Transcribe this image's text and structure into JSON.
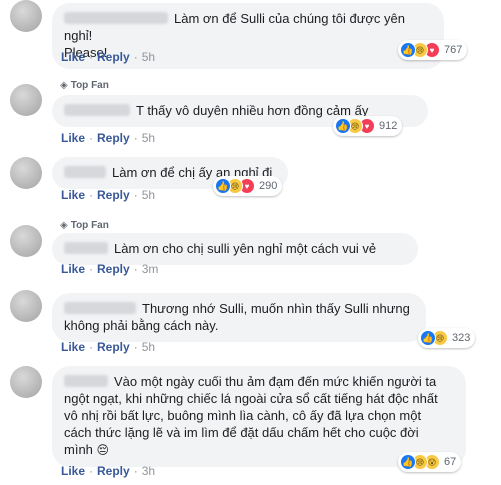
{
  "comments": [
    {
      "top_fan": "",
      "text_lines": [
        "Làm ơn để Sulli của chúng tôi được yên nghỉ!",
        "Please!"
      ],
      "like": "Like",
      "reply": "Reply",
      "time": "5h",
      "reaction_count": "767",
      "reaction_icons": [
        "like-icon",
        "sad-icon",
        "love-icon"
      ]
    },
    {
      "top_fan": "Top Fan",
      "text_lines": [
        "T thấy vô duyên nhiều hơn đồng cảm ấy"
      ],
      "like": "Like",
      "reply": "Reply",
      "time": "5h",
      "reaction_count": "912",
      "reaction_icons": [
        "like-icon",
        "sad-icon",
        "love-icon"
      ]
    },
    {
      "top_fan": "",
      "text_lines": [
        "Làm ơn để chị ấy an nghỉ đi"
      ],
      "like": "Like",
      "reply": "Reply",
      "time": "5h",
      "reaction_count": "290",
      "reaction_icons": [
        "like-icon",
        "sad-icon",
        "love-icon"
      ]
    },
    {
      "top_fan": "Top Fan",
      "text_lines": [
        "Làm ơn cho chị sulli yên nghỉ một cách vui vẻ"
      ],
      "like": "Like",
      "reply": "Reply",
      "time": "3m",
      "reaction_count": "",
      "reaction_icons": []
    },
    {
      "top_fan": "",
      "text_lines": [
        "Thương nhớ Sulli, muốn nhìn thấy Sulli nhưng",
        "không phải bằng cách này."
      ],
      "like": "Like",
      "reply": "Reply",
      "time": "5h",
      "reaction_count": "323",
      "reaction_icons": [
        "like-icon",
        "sad-icon"
      ]
    },
    {
      "top_fan": "",
      "text_lines": [
        "Vào một ngày cuối thu ảm đạm đến mức khiến người ta",
        "ngột ngạt, khi những chiếc lá ngoài cửa sổ cất tiếng hát độc nhất",
        "vô nhị rồi bất lực, buông mình lìa cành, cô ấy đã lựa chọn một",
        "cách thức lặng lẽ và im lìm để đặt dấu chấm hết cho cuộc đời",
        "mình"
      ],
      "emoji": "😔",
      "like": "Like",
      "reply": "Reply",
      "time": "3h",
      "reaction_count": "67",
      "reaction_icons": [
        "like-icon",
        "sad-icon",
        "wow-icon"
      ]
    }
  ],
  "colors": {
    "bubble_bg": "#f2f3f5",
    "link": "#385898",
    "meta": "#90949c",
    "like": "#1877f2",
    "love": "#f33e58",
    "sad": "#f7c945"
  }
}
